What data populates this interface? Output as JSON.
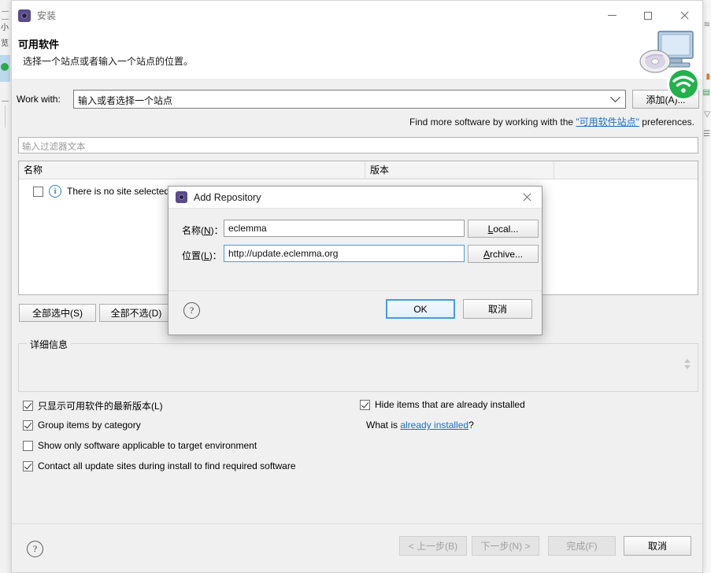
{
  "window": {
    "title": "安装",
    "icon": "install-gear-icon",
    "controls": {
      "minimize": "minimize",
      "maximize": "maximize",
      "close": "close"
    }
  },
  "header": {
    "title": "可用软件",
    "subtitle": "选择一个站点或者输入一个站点的位置。",
    "graphic": "computer-cd-icon"
  },
  "work_with": {
    "label": "Work with:",
    "value": "输入或者选择一个站点",
    "placeholder": "输入或者选择一个站点",
    "add_button": "添加(A)...",
    "caret": "chevron-down-icon"
  },
  "find_more": {
    "prefix": "Find more software by working with the ",
    "link": "\"可用软件站点\"",
    "suffix": " preferences."
  },
  "filter": {
    "placeholder": "输入过滤器文本",
    "value": ""
  },
  "tree": {
    "columns": [
      "名称",
      "版本"
    ],
    "rows": [
      {
        "checked": false,
        "icon": "info-icon",
        "name": "There is no site selected",
        "version": ""
      }
    ]
  },
  "selection_buttons": {
    "select_all": "全部选中(S)",
    "deselect_all": "全部不选(D)"
  },
  "details": {
    "legend": "详细信息",
    "text": "",
    "spinner": "spinner-updown-icon"
  },
  "options": {
    "left": [
      {
        "label": "只显示可用软件的最新版本(L)",
        "checked": true
      },
      {
        "label": "Group items by category",
        "checked": true
      },
      {
        "label": "Show only software applicable to target environment",
        "checked": false
      },
      {
        "label": "Contact all update sites during install to find required software",
        "checked": true
      }
    ],
    "right": {
      "checkbox": {
        "label": "Hide items that are already installed",
        "checked": true
      },
      "what_is_prefix": "What is ",
      "what_is_link": "already installed",
      "what_is_suffix": "?"
    }
  },
  "footer": {
    "help": "help-icon",
    "buttons": [
      {
        "label": "< 上一步(B)",
        "enabled": false
      },
      {
        "label": "下一步(N) >",
        "enabled": false
      },
      {
        "label": "完成(F)",
        "enabled": false
      },
      {
        "label": "取消",
        "enabled": true
      }
    ]
  },
  "dialog": {
    "title": "Add Repository",
    "icon": "install-gear-icon",
    "close": "close-icon",
    "name_label": "名称(N)：",
    "name_value": "eclemma",
    "location_label": "位置(L)：",
    "location_value": "http://update.eclemma.org",
    "local_button": "Local...",
    "archive_button": "Archive...",
    "help": "help-icon",
    "ok_button": "OK",
    "cancel_button": "取消"
  },
  "colors": {
    "link": "#1a6fc4",
    "default_button_border": "#4a9be0",
    "dialog_title_icon": "#5b4a8c",
    "wifi_badge": "#22b14c"
  },
  "background": {
    "wifi_badge": "wifi-icon",
    "left_labels": [
      "小",
      "览"
    ]
  }
}
